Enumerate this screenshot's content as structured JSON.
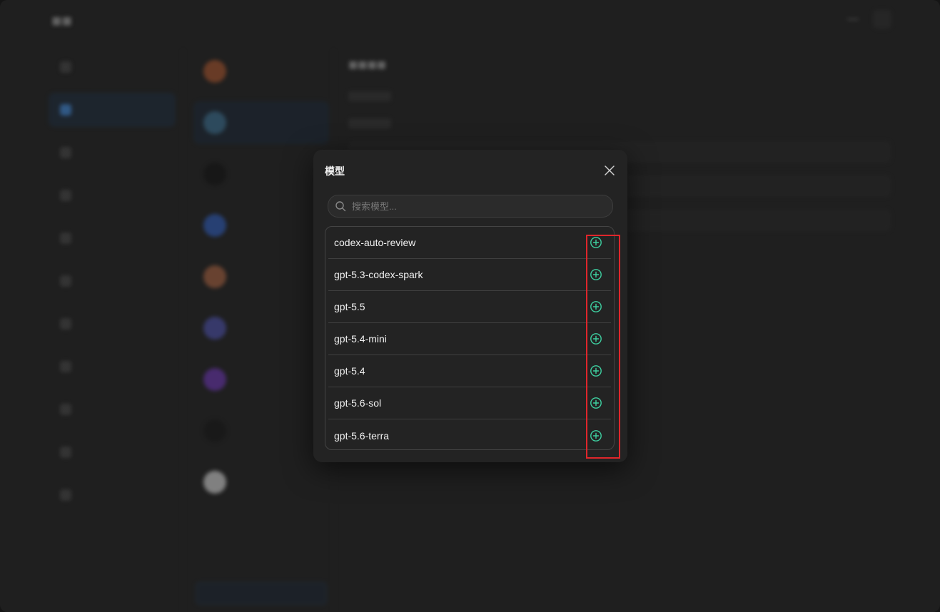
{
  "modal": {
    "title": "模型",
    "search_placeholder": "搜索模型..."
  },
  "models": [
    {
      "name": "codex-auto-review"
    },
    {
      "name": "gpt-5.3-codex-spark"
    },
    {
      "name": "gpt-5.5"
    },
    {
      "name": "gpt-5.4-mini"
    },
    {
      "name": "gpt-5.4"
    },
    {
      "name": "gpt-5.6-sol"
    },
    {
      "name": "gpt-5.6-terra"
    }
  ],
  "colors": {
    "accent": "#3ecfa0",
    "highlight": "#e0262b"
  },
  "icons": {
    "close": "close-icon",
    "search": "search-icon",
    "add": "plus-circle-icon"
  }
}
